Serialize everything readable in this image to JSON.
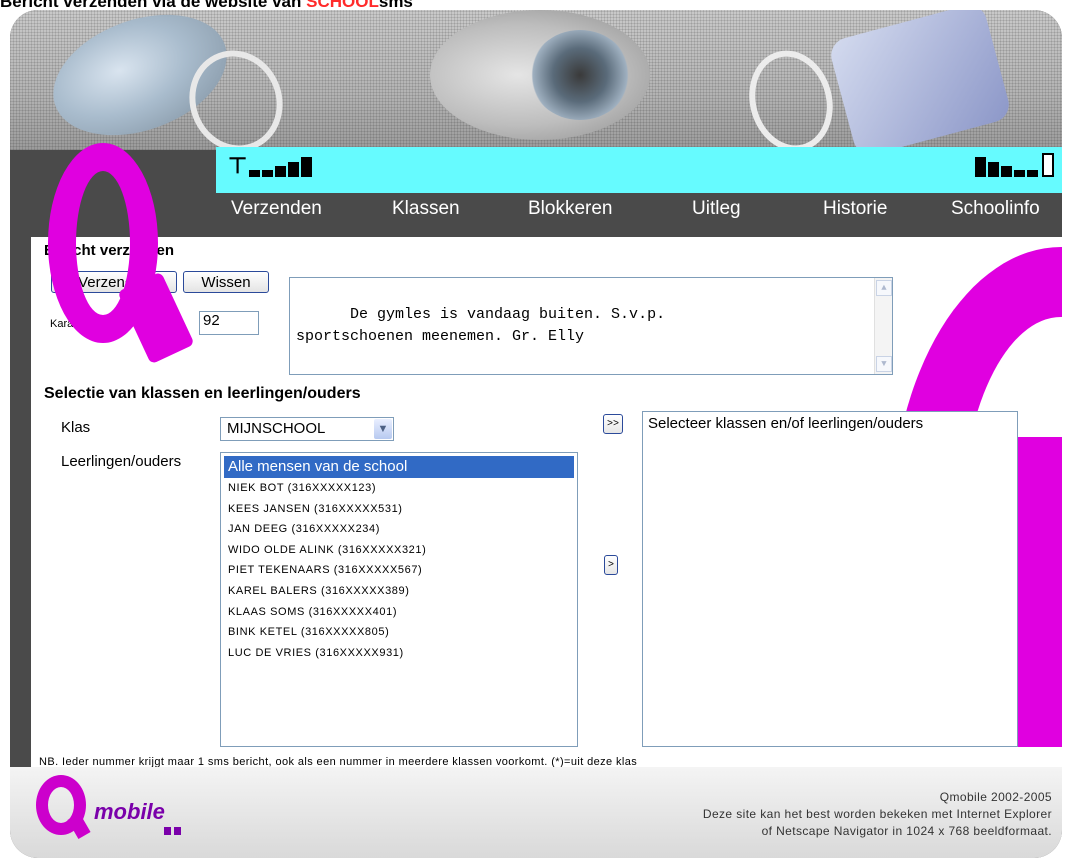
{
  "caption": {
    "prefix": "Bericht verzenden via de website van ",
    "brand": "SCHOOL",
    "suffix": "sms"
  },
  "status_icons": [
    "signal-icon",
    "battery-icon"
  ],
  "nav": {
    "items": [
      "Verzenden",
      "Klassen",
      "Blokkeren",
      "Uitleg",
      "Historie",
      "Schoolinfo"
    ]
  },
  "compose": {
    "title": "Bericht verzenden",
    "send_label": "Verzenden",
    "clear_label": "Wissen",
    "remaining_label": "Karakters nog over:",
    "remaining_value": "92",
    "message": "De gymles is vandaag buiten. S.v.p.\nsportschoenen meenemen. Gr. Elly"
  },
  "selection": {
    "title": "Selectie van klassen en leerlingen/ouders",
    "class_label": "Klas",
    "class_value": "MIJNSCHOOL",
    "people_label": "Leerlingen/ouders",
    "people": [
      "Alle mensen van de school",
      "NIEK  BOT  (316XXXXX123)",
      "KEES  JANSEN  (316XXXXX531)",
      "JAN  DEEG  (316XXXXX234)",
      "WIDO  OLDE  ALINK  (316XXXXX321)",
      "PIET  TEKENAARS  (316XXXXX567)",
      "KAREL  BALERS  (316XXXXX389)",
      "KLAAS  SOMS  (316XXXXX401)",
      "BINK  KETEL  (316XXXXX805)",
      "LUC  DE  VRIES  (316XXXXX931)"
    ],
    "add_all_label": ">>",
    "add_one_label": ">",
    "target_placeholder": "Selecteer klassen en/of leerlingen/ouders"
  },
  "note": "NB. Ieder nummer krijgt maar 1 sms bericht, ook als een nummer in meerdere klassen voorkomt.    (*)=uit deze klas",
  "footer": {
    "logo_text": "mobile",
    "copyright": "Qmobile 2002-2005",
    "browser_line1": "Deze site kan het best worden bekeken met Internet Explorer",
    "browser_line2": "of Netscape Navigator in 1024 x 768 beeldformaat."
  },
  "colors": {
    "accent_magenta": "#e000e0",
    "status_cyan": "#66fbff",
    "frame_gray": "#4a4a4a",
    "brand_red": "#ff2a2a"
  }
}
